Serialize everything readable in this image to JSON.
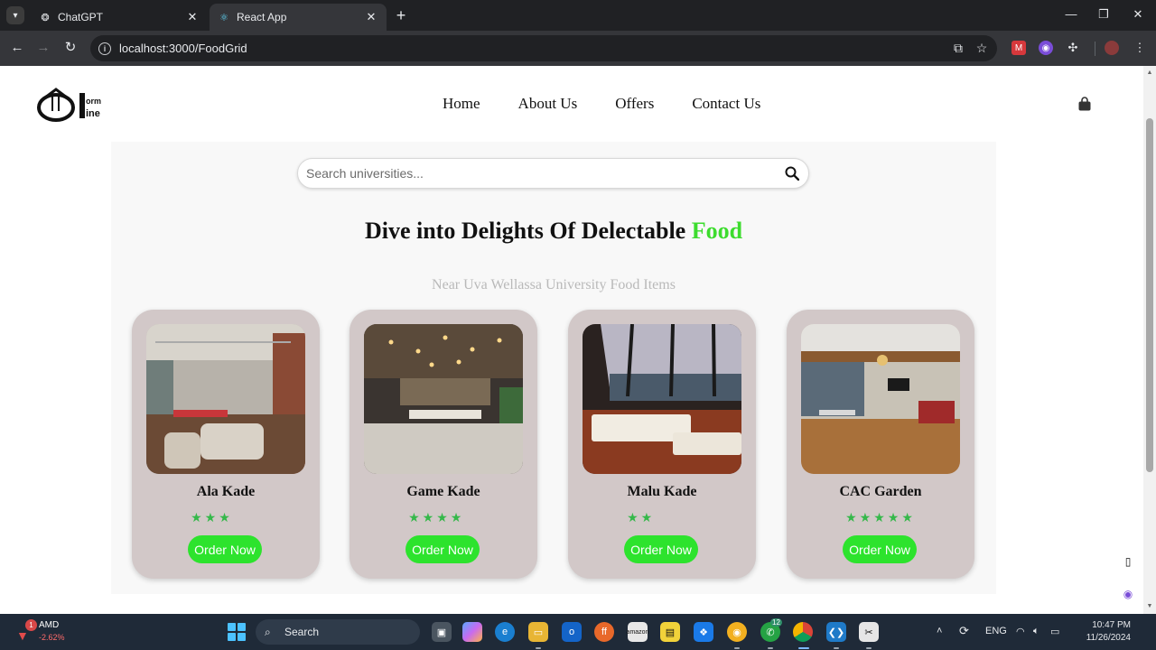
{
  "browser": {
    "tabs": [
      {
        "title": "ChatGPT",
        "active": false
      },
      {
        "title": "React App",
        "active": true
      }
    ],
    "url": "localhost:3000/FoodGrid"
  },
  "site": {
    "brand": "Dorm Dine",
    "nav": [
      "Home",
      "About Us",
      "Offers",
      "Contact Us"
    ],
    "search_placeholder": "Search universities...",
    "headline": "Dive into Delights Of Delectable",
    "headline_accent": "Food",
    "subheading": "Near Uva Wellassa University Food Items",
    "cards": [
      {
        "name": "Ala Kade",
        "rating": 3,
        "button": "Order Now",
        "photo": "restaurant-interior-brick"
      },
      {
        "name": "Game Kade",
        "rating": 4,
        "button": "Order Now",
        "photo": "restaurant-interior-pendant-lights"
      },
      {
        "name": "Malu Kade",
        "rating": 2,
        "button": "Order Now",
        "photo": "restaurant-interior-city-view"
      },
      {
        "name": "CAC Garden",
        "rating": 5,
        "button": "Order Now",
        "photo": "restaurant-interior-wooden-floor"
      }
    ],
    "accent_color": "#3ddc2e",
    "star_color": "#35b84a",
    "card_color": "#d2c8c8"
  },
  "taskbar": {
    "stock": {
      "symbol": "AMD",
      "change": "-2.62%",
      "badge": "1"
    },
    "search_label": "Search",
    "language": "ENG",
    "time": "10:47 PM",
    "date": "11/26/2024",
    "whatsapp_badge": "12"
  }
}
